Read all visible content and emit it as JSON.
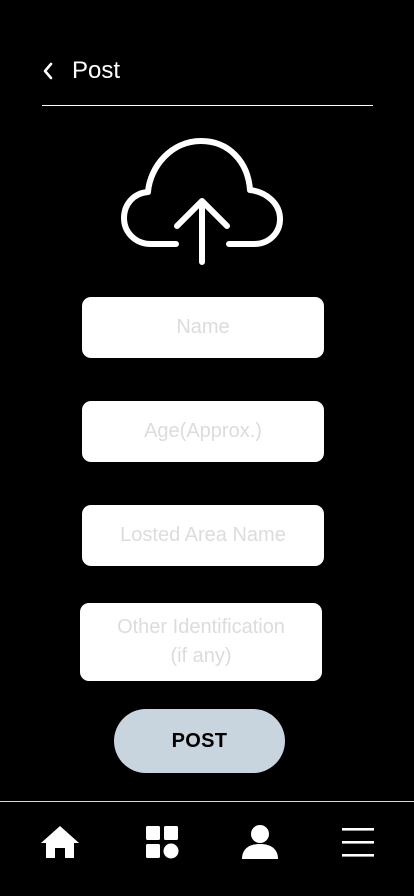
{
  "header": {
    "title": "Post",
    "back_icon": "chevron-left-icon"
  },
  "upload": {
    "icon": "cloud-upload-icon"
  },
  "form": {
    "name_placeholder": "Name",
    "age_placeholder": "Age(Approx.)",
    "area_placeholder": "Losted Area Name",
    "identification_placeholder": "Other Identification\n(if any)"
  },
  "submit": {
    "label": "POST"
  },
  "colors": {
    "background": "#000000",
    "field": "#ffffff",
    "placeholder": "#dcdcdc",
    "button": "#c9d5de"
  },
  "tabbar": {
    "items": [
      {
        "icon": "home-icon"
      },
      {
        "icon": "grid-icon"
      },
      {
        "icon": "user-icon"
      },
      {
        "icon": "menu-icon"
      }
    ]
  }
}
